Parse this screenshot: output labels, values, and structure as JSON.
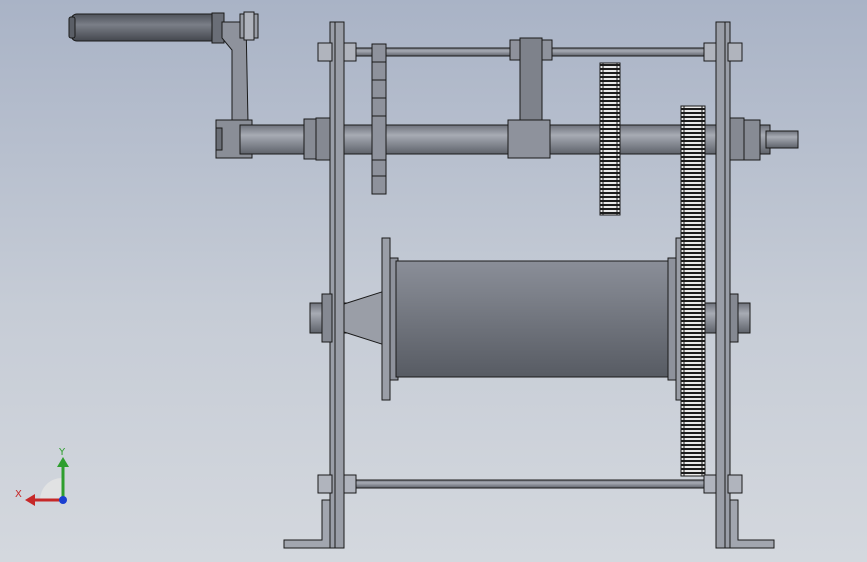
{
  "viewport": {
    "background_top": "#a9b3c6",
    "background_bottom": "#d4d8de"
  },
  "model": {
    "part_fill": "#8e929c",
    "part_fill_dark": "#5f636c",
    "part_fill_light": "#b4b8c1",
    "outline": "#1a1a1a",
    "gear_teeth": "#1a1a1a",
    "gear_face": "#e6e6e6"
  },
  "triad": {
    "x_label": "X",
    "y_label": "Y",
    "x_color": "#c62828",
    "y_color": "#2e9e2e",
    "z_color": "#1a3fd1"
  }
}
